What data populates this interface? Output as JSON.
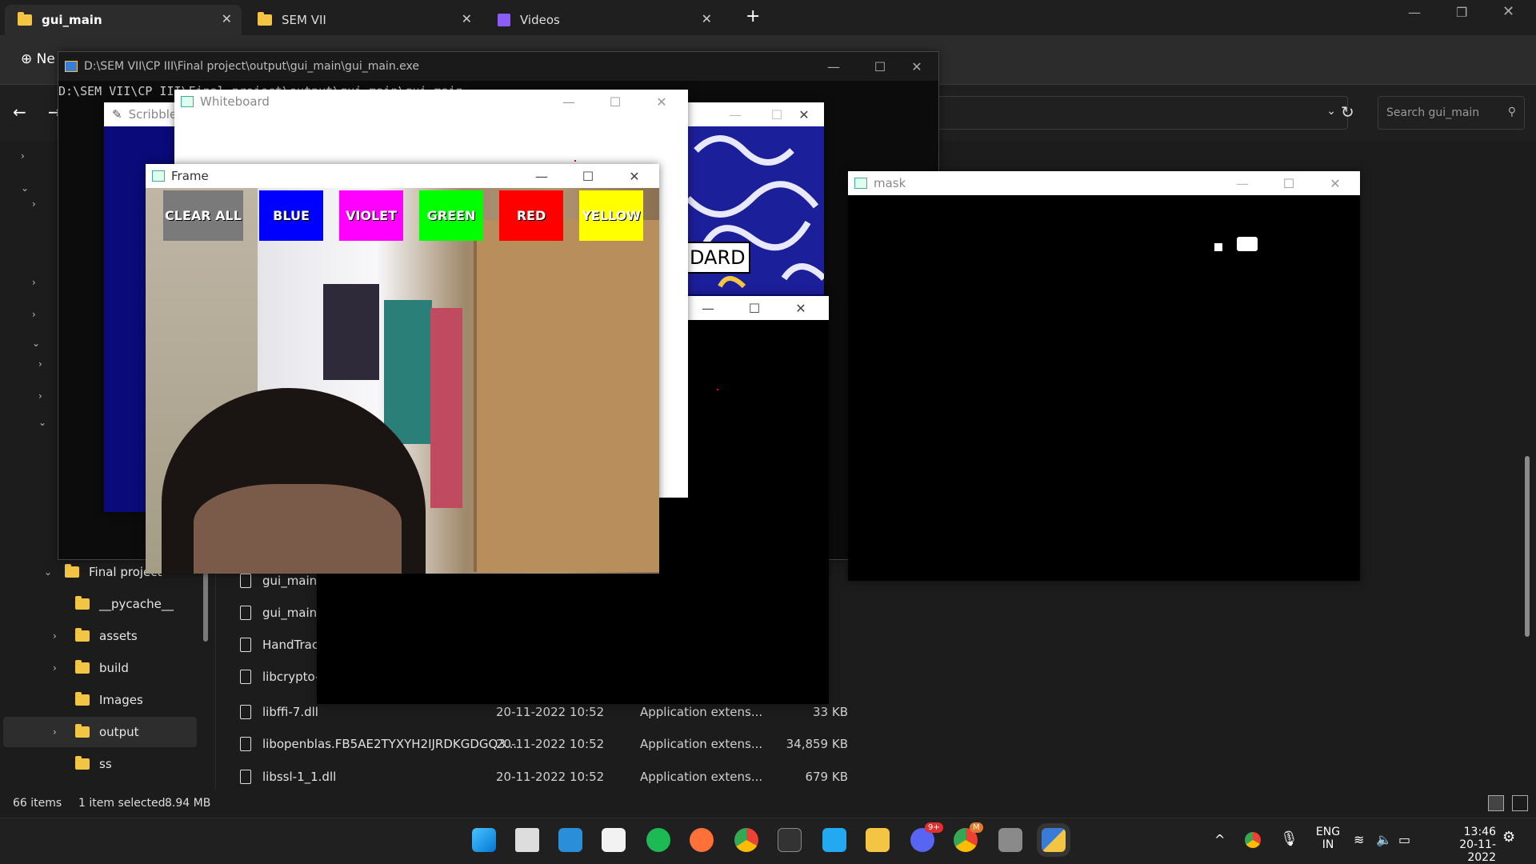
{
  "explorer": {
    "tabs": [
      {
        "label": "gui_main"
      },
      {
        "label": "SEM VII"
      },
      {
        "label": "Videos"
      }
    ],
    "new_label": "Ne",
    "search_placeholder": "Search gui_main",
    "tree": [
      "Final project",
      "__pycache__",
      "assets",
      "build",
      "Images",
      "output",
      "ss"
    ],
    "files": [
      {
        "name": "gui_main.py",
        "date": "",
        "type": "",
        "size": ""
      },
      {
        "name": "gui_main.sp",
        "date": "",
        "type": "",
        "size": ""
      },
      {
        "name": "HandTracke",
        "date": "",
        "type": "",
        "size": ""
      },
      {
        "name": "libcrypto-1_",
        "date": "",
        "type": "",
        "size": ""
      },
      {
        "name": "libffi-7.dll",
        "date": "20-11-2022 10:52",
        "type": "Application extens...",
        "size": "33 KB"
      },
      {
        "name": "libopenblas.FB5AE2TYXYH2IJRDKGDGQ3...",
        "date": "20-11-2022 10:52",
        "type": "Application extens...",
        "size": "34,859 KB"
      },
      {
        "name": "libssl-1_1.dll",
        "date": "20-11-2022 10:52",
        "type": "Application extens...",
        "size": "679 KB"
      }
    ],
    "status": {
      "items": "66 items",
      "selected": "1 item selected",
      "size": "8.94 MB"
    }
  },
  "console": {
    "title": "D:\\SEM VII\\CP III\\Final project\\output\\gui_main\\gui_main.exe",
    "line": "D:\\SEM VII\\CP III\\Final project\\output\\gui_main\\gui_main"
  },
  "windows": {
    "scribbler": "Scribbler",
    "whiteboard": "Whiteboard",
    "frame": "Frame",
    "mask": "mask",
    "board_text": "DARD"
  },
  "frame_buttons": [
    {
      "label": "CLEAR ALL",
      "color": "#7a7a7a"
    },
    {
      "label": "BLUE",
      "color": "#0000ff"
    },
    {
      "label": "VIOLET",
      "color": "#ff00ff"
    },
    {
      "label": "GREEN",
      "color": "#00ff00"
    },
    {
      "label": "RED",
      "color": "#ff0000"
    },
    {
      "label": "YELLOW",
      "color": "#ffff00"
    }
  ],
  "taskbar": {
    "lang1": "ENG",
    "lang2": "IN",
    "time": "13:46",
    "date": "20-11-2022",
    "discord_badge": "9+",
    "chrome_badge": "M"
  }
}
